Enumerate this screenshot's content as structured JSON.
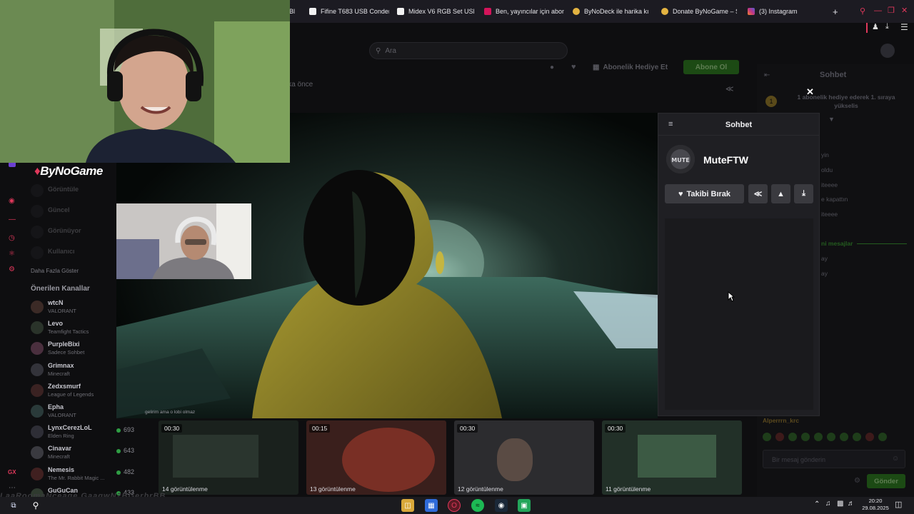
{
  "browser": {
    "tabs": [
      {
        "title": "Bl",
        "color": "#3a3a44"
      },
      {
        "title": "Fifine T683 USB Conden",
        "color": "#f2f2f2"
      },
      {
        "title": "Midex V6 RGB Set USB",
        "color": "#f2f2f2"
      },
      {
        "title": "Ben, yayıncılar için abon",
        "color": "#d4145a"
      },
      {
        "title": "ByNoDeck ile harika kı",
        "color": "#e3b341"
      },
      {
        "title": "Donate ByNoGame – St",
        "color": "#e3b341"
      },
      {
        "title": "(3) Instagram",
        "color": "#c13584"
      }
    ],
    "new_tab": "+"
  },
  "header": {
    "search_placeholder": "Ara",
    "gift_sub": "Abonelik Hediye Et",
    "subscribe": "Abone Ol",
    "time_ago": "kika önce"
  },
  "streamer_overlay": {
    "brand": "ByNoGame"
  },
  "sidebar": {
    "followed_faded": [
      "Görüntüle",
      "Güncel",
      "Görünüyor",
      "Kullanıcı"
    ],
    "show_more": "Daha Fazla Göster",
    "recommended_title": "Önerilen Kanallar",
    "channels": [
      {
        "name": "wtcN",
        "game": "VALORANT",
        "viewers": ""
      },
      {
        "name": "Levo",
        "game": "Teamfight Tactics",
        "viewers": ""
      },
      {
        "name": "PurpleBixi",
        "game": "Sadece Sohbet",
        "viewers": ""
      },
      {
        "name": "Grimnax",
        "game": "Minecraft",
        "viewers": ""
      },
      {
        "name": "Zedxsmurf",
        "game": "League of Legends",
        "viewers": ""
      },
      {
        "name": "Epha",
        "game": "VALORANT",
        "viewers": ""
      },
      {
        "name": "LynxCerezLoL",
        "game": "Elden Ring",
        "viewers": "693"
      },
      {
        "name": "Cinavar",
        "game": "Minecraft",
        "viewers": "643"
      },
      {
        "name": "Nemesis",
        "game": "The Mr. Rabbit Magic ...",
        "viewers": "482"
      },
      {
        "name": "GuGuCan",
        "game": "",
        "viewers": "433"
      }
    ]
  },
  "video": {
    "subtitle": "gelirim ama o lobi olmaz"
  },
  "clips": [
    {
      "duration": "00:30",
      "views": "14 görüntülenme"
    },
    {
      "duration": "00:15",
      "views": "13 görüntülenme"
    },
    {
      "duration": "00:30",
      "views": "12 görüntülenme"
    },
    {
      "duration": "00:30",
      "views": "11 görüntülenme"
    }
  ],
  "chat_bg": {
    "title": "Sohbet",
    "gift_notice": "1 abonelik hediye ederek 1. sıraya yükselis",
    "gift_rank": "1",
    "lines": [
      "yin",
      "oldu",
      "iteeee",
      "e kapattın",
      "iteeee"
    ],
    "divider": "ni mesajlar",
    "lines2": [
      "ay",
      "ay"
    ],
    "user": "Alperrrn_krc",
    "input_placeholder": "Bir mesaj gönderin",
    "send": "Gönder"
  },
  "popup": {
    "title": "Sohbet",
    "username": "MuteFTW",
    "avatar_text": "MUTE",
    "unfollow": "Takibi Bırak"
  },
  "taskbar": {
    "time": "20:20",
    "date": "29.08.2025"
  },
  "bottom_watermark": "LaaRoomaNceage GaagwN2BGerbrBB"
}
